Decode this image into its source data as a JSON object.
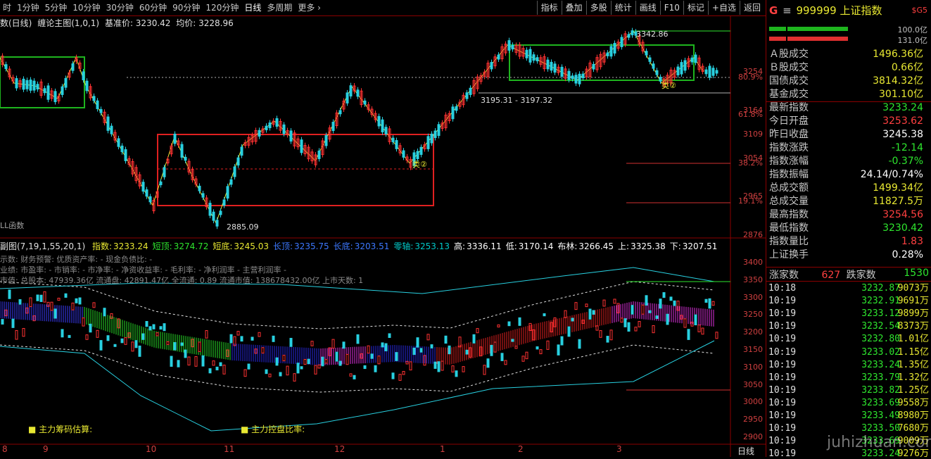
{
  "toolbar": {
    "periods": [
      "时",
      "1分钟",
      "5分钟",
      "10分钟",
      "30分钟",
      "60分钟",
      "90分钟",
      "120分钟",
      "日线",
      "多周期",
      "更多 ›"
    ],
    "buttons": [
      "指标",
      "叠加",
      "多股",
      "统计",
      "画线",
      "F10",
      "标记",
      "+自选",
      "返回"
    ]
  },
  "main_header": {
    "name": "数(日线)",
    "indicator": "缠论主图(1,0,1)",
    "base_label": "基准价: 3230.42",
    "avg_label": "均价: 3228.96"
  },
  "main_annotations": {
    "high": "3342.86",
    "low": "2885.09",
    "range": "3195.31 - 3197.32",
    "fn_label": "LL函数",
    "class2": "类②"
  },
  "main_axis": {
    "prices": [
      "3254",
      "3164",
      "3109",
      "3054",
      "2965",
      "2876"
    ],
    "percents": [
      "80.9%",
      "61.8%",
      "38.2%",
      "19.1%"
    ]
  },
  "sub_header": {
    "name": "副图(7,19,1,55,20,1)",
    "items": [
      {
        "k": "指数:",
        "v": "3233.24",
        "c": "#e8e832"
      },
      {
        "k": "短顶:",
        "v": "3274.72",
        "c": "#2ee62e"
      },
      {
        "k": "短底:",
        "v": "3245.03",
        "c": "#e8e832"
      },
      {
        "k": "长顶:",
        "v": "3235.75",
        "c": "#3c78ff"
      },
      {
        "k": "长底:",
        "v": "3203.51",
        "c": "#3c78ff"
      },
      {
        "k": "零轴:",
        "v": "3253.13",
        "c": "#00c8c8"
      },
      {
        "k": "高:",
        "v": "3336.11",
        "c": "#ffffff"
      },
      {
        "k": "低:",
        "v": "3170.14",
        "c": "#ffffff"
      },
      {
        "k": "布林:",
        "v": "3266.45",
        "c": "#ffffff"
      },
      {
        "k": "上:",
        "v": "3325.38",
        "c": "#ffffff"
      },
      {
        "k": "下:",
        "v": "3207.51",
        "c": "#ffffff"
      }
    ]
  },
  "sub_info": {
    "line1": "示数: 财务预警: 优质资产率: -  现金负债比: -",
    "line2": "业绩: 市盈率: - 市销率: - 市净率: - 净资收益率: - 毛利率: - 净利润率 - 主营利润率 -",
    "line3": "市值: 总股本: 47939.36亿 流通盘: 42891.47亿 全流通: 0.89 流通市值: 138678432.00亿 上市天数: 1",
    "chip1": "主力筹码估算:",
    "chip2": "主力控盘比率:"
  },
  "sub_axis": [
    "3400",
    "3350",
    "3300",
    "3250",
    "3200",
    "3150",
    "3100",
    "3050",
    "3000",
    "2950",
    "2900"
  ],
  "date_axis": {
    "months": [
      "8",
      "9",
      "10",
      "11",
      "12",
      "1",
      "2",
      "3"
    ],
    "period_label": "日线"
  },
  "quote": {
    "prefix": "G",
    "code": "999999",
    "name": "上证指数",
    "tag": "$G5",
    "bar1": "100.0亿",
    "bar2": "131.0亿",
    "rows": [
      {
        "label": "Ａ股成交",
        "value": "1496.36亿",
        "color": "#e8e832"
      },
      {
        "label": "Ｂ股成交",
        "value": "0.66亿",
        "color": "#e8e832"
      },
      {
        "label": "国债成交",
        "value": "3814.32亿",
        "color": "#e8e832"
      },
      {
        "label": "基金成交",
        "value": "301.10亿",
        "color": "#e8e832"
      },
      {
        "label": "最新指数",
        "value": "3233.24",
        "color": "#2ee62e"
      },
      {
        "label": "今日开盘",
        "value": "3253.62",
        "color": "#ff4040"
      },
      {
        "label": "昨日收盘",
        "value": "3245.38",
        "color": "#ffffff"
      },
      {
        "label": "指数涨跌",
        "value": "-12.14",
        "color": "#2ee62e"
      },
      {
        "label": "指数涨幅",
        "value": "-0.37%",
        "color": "#2ee62e"
      },
      {
        "label": "指数振幅",
        "value": "24.14/0.74%",
        "color": "#ffffff"
      },
      {
        "label": "总成交额",
        "value": "1499.34亿",
        "color": "#e8e832"
      },
      {
        "label": "总成交量",
        "value": "11827.5万",
        "color": "#e8e832"
      },
      {
        "label": "最高指数",
        "value": "3254.56",
        "color": "#ff4040"
      },
      {
        "label": "最低指数",
        "value": "3230.42",
        "color": "#2ee62e"
      },
      {
        "label": "指数量比",
        "value": "1.83",
        "color": "#ff4040"
      },
      {
        "label": "上证换手",
        "value": "0.28%",
        "color": "#ffffff"
      }
    ],
    "up_label": "涨家数",
    "up_value": "627",
    "down_label": "跌家数",
    "down_value": "1530",
    "ticks": [
      {
        "t": "10:18",
        "p": "3232.87",
        "v": "9073万"
      },
      {
        "t": "10:19",
        "p": "3232.91",
        "v": "9691万"
      },
      {
        "t": "10:19",
        "p": "3233.12",
        "v": "9899万"
      },
      {
        "t": "10:19",
        "p": "3232.54",
        "v": "8373万"
      },
      {
        "t": "10:19",
        "p": "3232.80",
        "v": "1.01亿"
      },
      {
        "t": "10:19",
        "p": "3233.02",
        "v": "1.15亿"
      },
      {
        "t": "10:19",
        "p": "3233.24",
        "v": "1.35亿"
      },
      {
        "t": "10:19",
        "p": "3233.79",
        "v": "1.32亿"
      },
      {
        "t": "10:19",
        "p": "3233.82",
        "v": "1.25亿"
      },
      {
        "t": "10:19",
        "p": "3233.69",
        "v": "9558万"
      },
      {
        "t": "10:19",
        "p": "3233.49",
        "v": "8980万"
      },
      {
        "t": "10:19",
        "p": "3233.50",
        "v": "7680万"
      },
      {
        "t": "10:19",
        "p": "3233.69",
        "v": "9009万"
      },
      {
        "t": "10:19",
        "p": "3233.24",
        "v": "9276万"
      }
    ]
  },
  "watermark": "juhizhuan.com"
}
